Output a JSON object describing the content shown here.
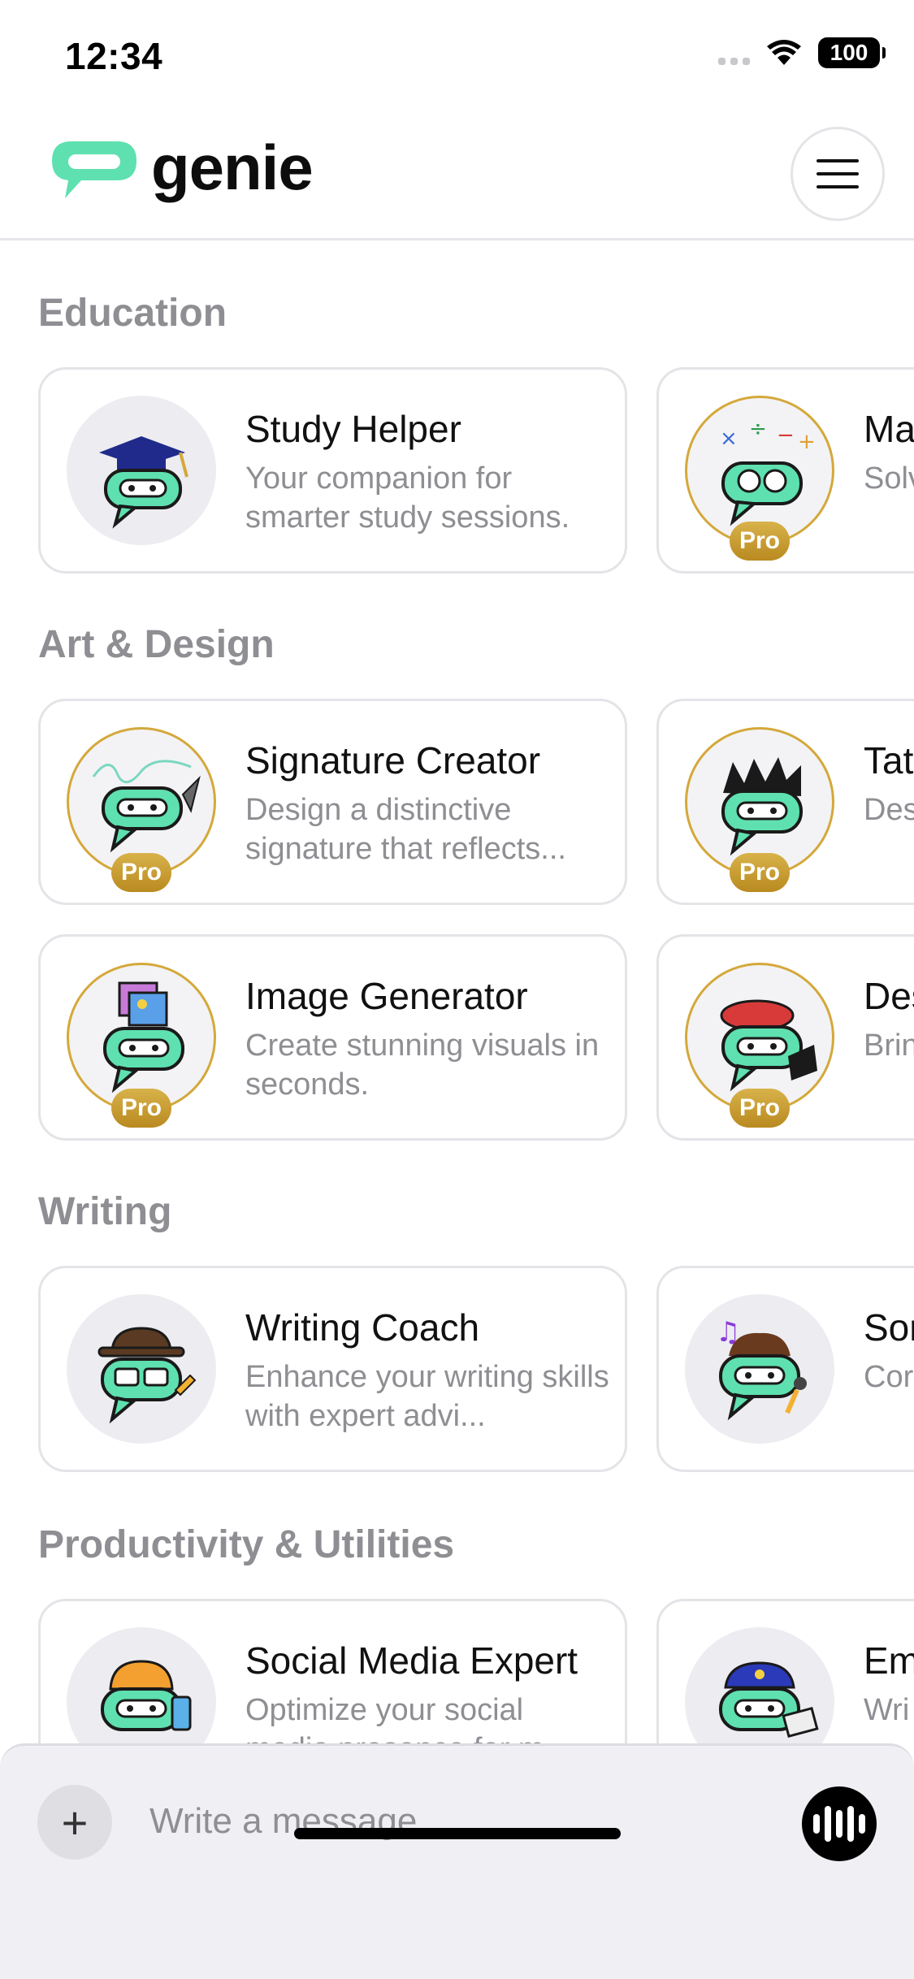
{
  "status_bar": {
    "time": "12:34",
    "battery": "100"
  },
  "header": {
    "logo_text": "genie",
    "logo_icon": "chat-bubble-logo",
    "menu_icon": "hamburger-menu-icon"
  },
  "sections": [
    {
      "title": "Education",
      "cards": [
        {
          "title": "Study Helper",
          "description": "Your companion for smarter study sessions.",
          "pro": false,
          "icon": "graduation-cap-icon"
        },
        {
          "title": "Ma",
          "description": "Solv pro",
          "pro": true,
          "icon": "math-symbols-icon"
        }
      ]
    },
    {
      "title": "Art & Design",
      "cards": [
        {
          "title": "Signature Creator",
          "description": "Design a distinctive signature that reflects...",
          "pro": true,
          "icon": "quill-pen-icon"
        },
        {
          "title": "Tat",
          "description": "Des tail",
          "pro": true,
          "icon": "tattoo-artist-icon"
        },
        {
          "title": "Image Generator",
          "description": "Create stunning visuals in seconds.",
          "pro": true,
          "icon": "image-frame-icon"
        },
        {
          "title": "Des",
          "description": "Brin idea",
          "pro": true,
          "icon": "beret-laptop-icon"
        }
      ]
    },
    {
      "title": "Writing",
      "cards": [
        {
          "title": "Writing Coach",
          "description": "Enhance your writing skills with expert advi...",
          "pro": false,
          "icon": "fedora-pencil-icon"
        },
        {
          "title": "Sor",
          "description": "Cor son",
          "pro": false,
          "icon": "music-notes-mic-icon"
        }
      ]
    },
    {
      "title": "Productivity & Utilities",
      "cards": [
        {
          "title": "Social Media Expert",
          "description": "Optimize your social media presence for m...",
          "pro": false,
          "icon": "cap-phone-icon"
        },
        {
          "title": "Em",
          "description": "Wri the",
          "pro": false,
          "icon": "police-cap-envelope-icon"
        }
      ]
    }
  ],
  "pro_label": "Pro",
  "composer": {
    "placeholder": "Write a message",
    "plus_label": "+"
  },
  "colors": {
    "accent": "#5fe0b0",
    "pro_gold": "#c89a2e",
    "muted": "#8e8e93"
  }
}
